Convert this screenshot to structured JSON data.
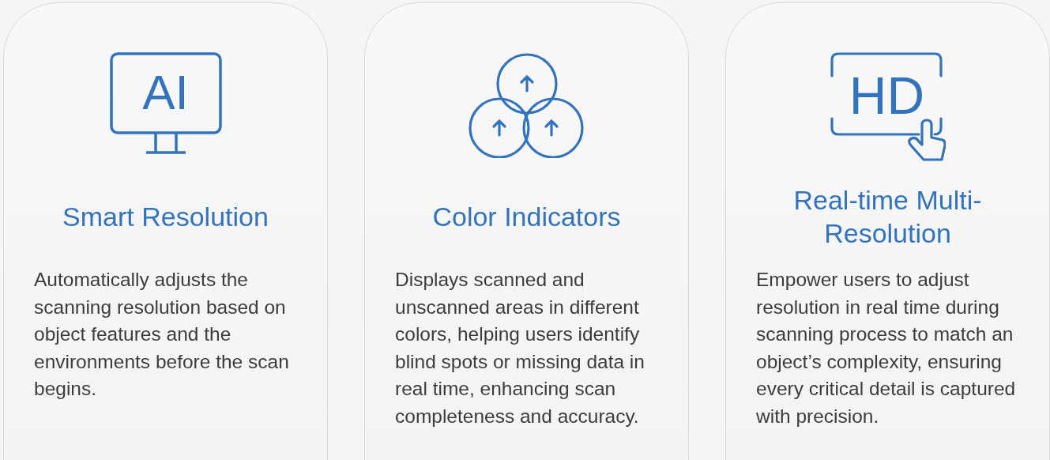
{
  "cards": [
    {
      "icon": {
        "kind": "monitor",
        "text": "AI"
      },
      "title": "Smart Resolution",
      "description": "Automatically adjusts the scanning resolution based on object features and the environments before the scan begins."
    },
    {
      "icon": {
        "kind": "circles"
      },
      "title": "Color Indicators",
      "description": "Displays scanned and unscanned areas in different colors, helping users identify blind spots or missing data in real time, enhancing scan completeness and accuracy."
    },
    {
      "icon": {
        "kind": "touch-screen",
        "text": "HD"
      },
      "title": "Real-time Multi-Resolution",
      "description": "Empower users to adjust resolution in real time during scanning process to match an object’s complexity, ensuring every critical detail is captured with precision."
    }
  ]
}
